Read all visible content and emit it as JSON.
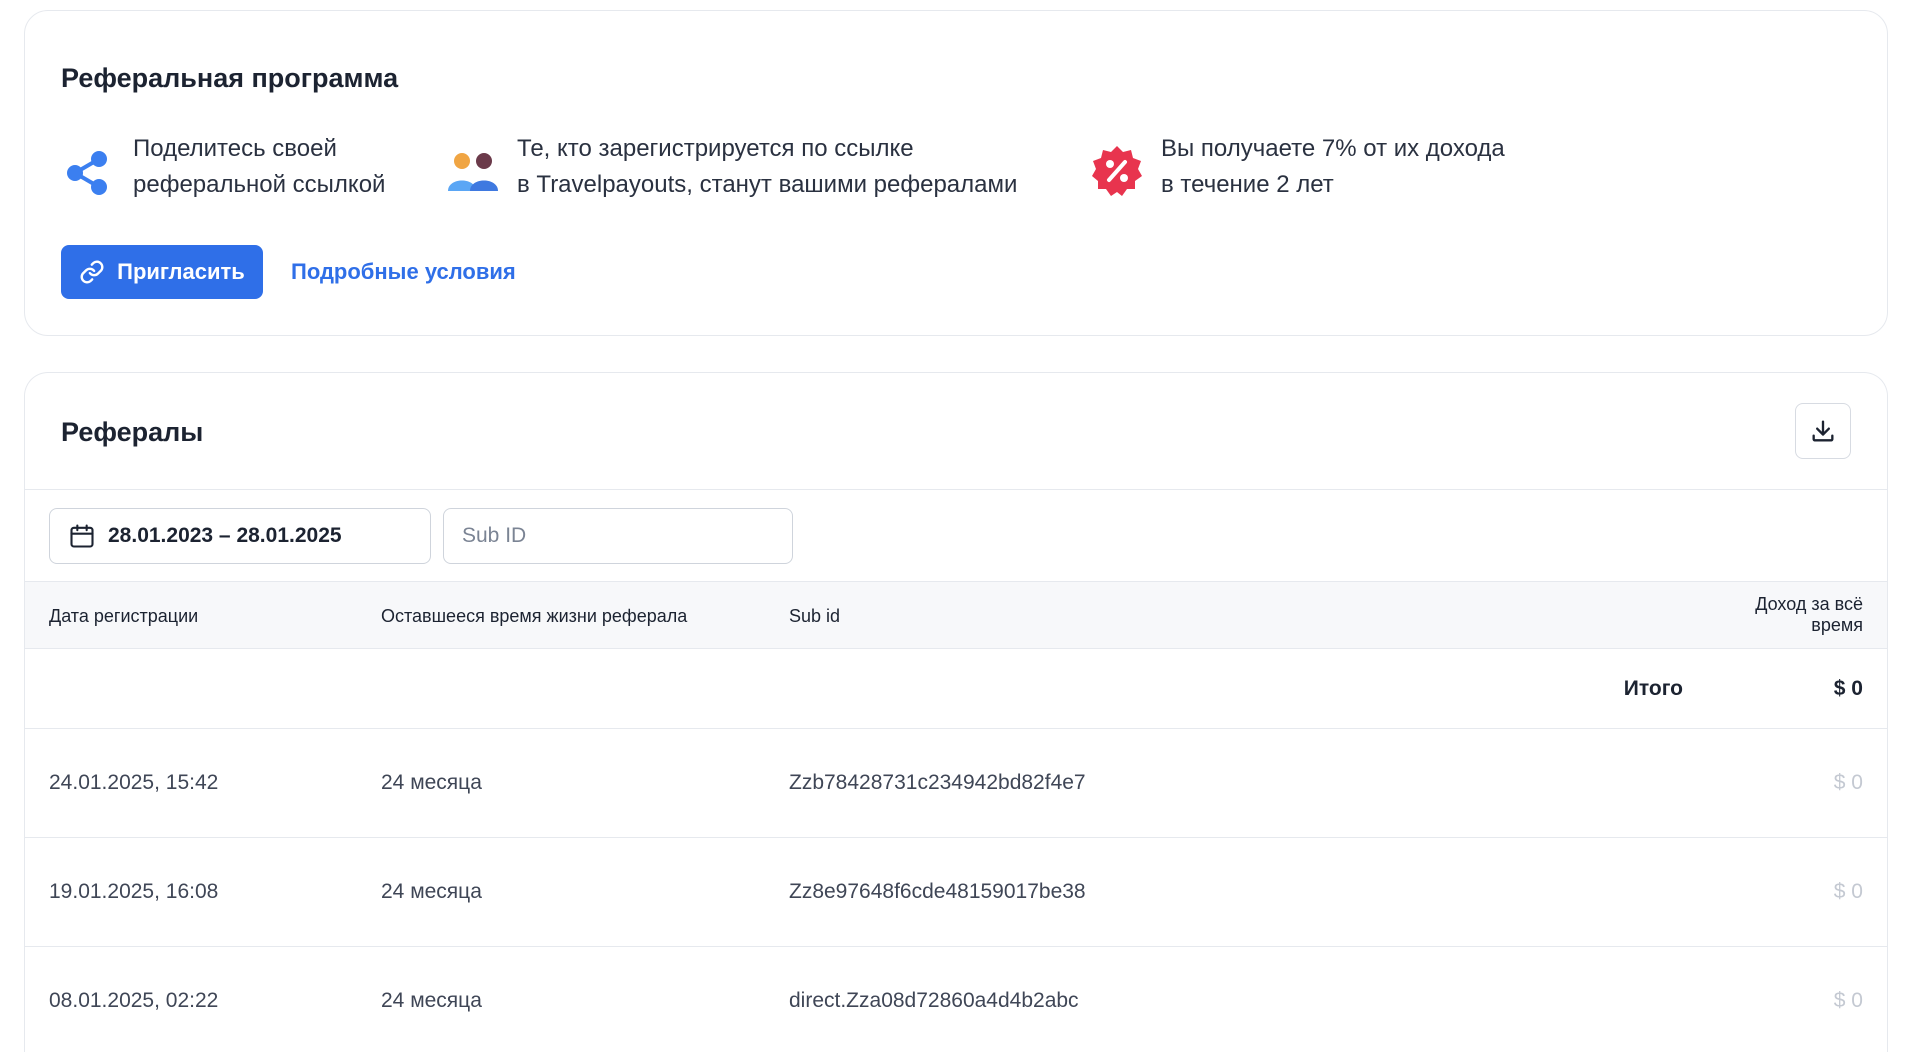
{
  "program": {
    "title": "Реферальная программа",
    "steps": [
      {
        "icon": "share-icon",
        "line1": "Поделитесь своей",
        "line2": "реферальной ссылкой"
      },
      {
        "icon": "users-icon",
        "line1": "Те, кто зарегистрируется по ссылке",
        "line2": "в Travelpayouts, станут вашими рефералами"
      },
      {
        "icon": "percent-badge-icon",
        "line1": "Вы получаете 7% от их дохода",
        "line2": "в течение 2 лет"
      }
    ],
    "invite_label": "Пригласить",
    "terms_label": "Подробные условия"
  },
  "referrals": {
    "title": "Рефералы",
    "date_range": "28.01.2023 – 28.01.2025",
    "subid_placeholder": "Sub ID",
    "columns": {
      "date": "Дата регистрации",
      "lifetime": "Оставшееся время жизни реферала",
      "subid": "Sub id",
      "income_line1": "Доход за всё",
      "income_line2": "время"
    },
    "total_label": "Итого",
    "total_value": "$ 0",
    "rows": [
      {
        "date": "24.01.2025, 15:42",
        "lifetime": "24 месяца",
        "subid": "Zzb78428731c234942bd82f4e7",
        "income": "$ 0"
      },
      {
        "date": "19.01.2025, 16:08",
        "lifetime": "24 месяца",
        "subid": "Zz8e97648f6cde48159017be38",
        "income": "$ 0"
      },
      {
        "date": "08.01.2025, 02:22",
        "lifetime": "24 месяца",
        "subid": "direct.Zza08d72860a4d4b2abc",
        "income": "$ 0"
      }
    ]
  },
  "colors": {
    "accent": "#2f6fe8",
    "text": "#1c2331",
    "muted": "#c4c9d2",
    "share_icon": "#3b7ff0",
    "percent_badge": "#e8344e"
  }
}
